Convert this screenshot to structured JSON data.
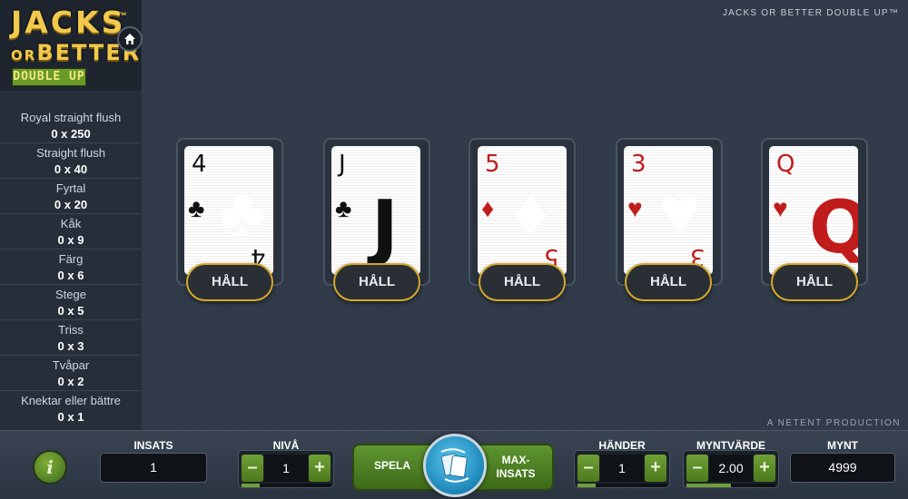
{
  "logo": {
    "line1": "JACKS",
    "tm": "™",
    "line2_small": "OR",
    "line2_big": "BETTER",
    "badge": "DOUBLE UP"
  },
  "game_title": "JACKS OR BETTER DOUBLE UP™",
  "producer": "A NETENT PRODUCTION",
  "paytable": [
    {
      "name": "Royal straight flush",
      "value": "0 x 250"
    },
    {
      "name": "Straight flush",
      "value": "0 x 40"
    },
    {
      "name": "Fyrtal",
      "value": "0 x 20"
    },
    {
      "name": "Kåk",
      "value": "0 x 9"
    },
    {
      "name": "Färg",
      "value": "0 x 6"
    },
    {
      "name": "Stege",
      "value": "0 x 5"
    },
    {
      "name": "Triss",
      "value": "0 x 3"
    },
    {
      "name": "Tvåpar",
      "value": "0 x 2"
    },
    {
      "name": "Knektar eller bättre",
      "value": "0 x 1"
    }
  ],
  "cards": [
    {
      "rank": "4",
      "suit": "♣",
      "color": "black"
    },
    {
      "rank": "J",
      "suit": "♣",
      "color": "black"
    },
    {
      "rank": "5",
      "suit": "♦",
      "color": "red"
    },
    {
      "rank": "3",
      "suit": "♥",
      "color": "red"
    },
    {
      "rank": "Q",
      "suit": "♥",
      "color": "red"
    }
  ],
  "hold_label": "HÅLL",
  "controls": {
    "insats": {
      "label": "INSATS",
      "value": "1"
    },
    "niva": {
      "label": "NIVÅ",
      "value": "1",
      "minus": "–",
      "plus": "+",
      "level": 0.2
    },
    "spela": "SPELA",
    "maxinsats_1": "MAX-",
    "maxinsats_2": "INSATS",
    "hander": {
      "label": "HÄNDER",
      "value": "1",
      "minus": "–",
      "plus": "+",
      "level": 0.2
    },
    "myntvarde": {
      "label": "MYNTVÄRDE",
      "value": "2.00",
      "minus": "–",
      "plus": "+",
      "level": 0.5
    },
    "mynt": {
      "label": "MYNT",
      "value": "4999"
    },
    "info": "i"
  },
  "colors": {
    "accent_gold": "#d6a92a",
    "button_green": "#6fa035",
    "deal_blue": "#1c86b8",
    "card_red": "#c01c1c"
  }
}
